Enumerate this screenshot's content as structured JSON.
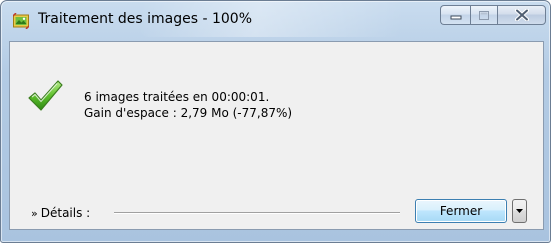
{
  "window": {
    "title": "Traitement des images - 100%",
    "icons": {
      "app": "image-batch-icon",
      "minimize": "minimize-icon",
      "maximize": "maximize-icon",
      "close": "close-icon",
      "status": "checkmark-icon",
      "dropdown": "chevron-down-icon"
    }
  },
  "result": {
    "line1": "6 images traitées en 00:00:01.",
    "line2": "Gain d'espace : 2,79 Mo (-77,87%)"
  },
  "details": {
    "arrows": "»",
    "label": "Détails :"
  },
  "buttons": {
    "close_label": "Fermer"
  },
  "colors": {
    "check_green": "#3a9b1e",
    "close_button_border": "#3c7fb1"
  }
}
